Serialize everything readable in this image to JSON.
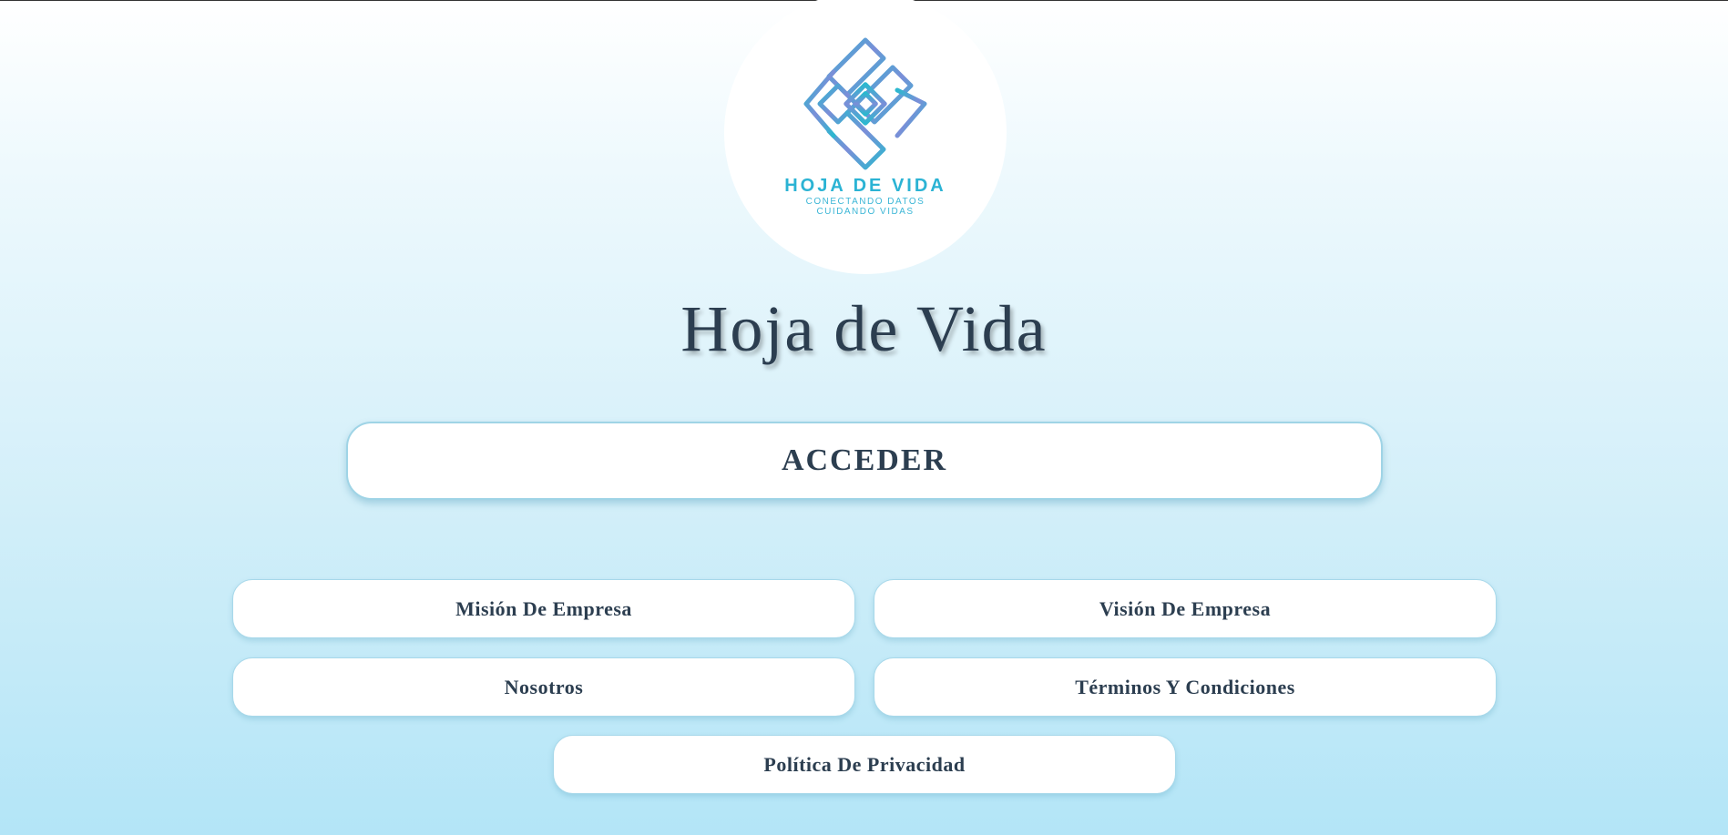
{
  "logo": {
    "icon": "hoja-de-vida-logo-icon",
    "title": "HOJA DE VIDA",
    "tagline_line1": "CONECTANDO DATOS",
    "tagline_line2": "CUIDANDO VIDAS"
  },
  "page": {
    "title": "Hoja de Vida"
  },
  "actions": {
    "access_label": "ACCEDER"
  },
  "links": {
    "mision": "Misión De Empresa",
    "vision": "Visión De Empresa",
    "nosotros": "Nosotros",
    "terminos": "Términos Y Condiciones",
    "privacidad": "Política De Privacidad"
  },
  "colors": {
    "text": "#2c3e50",
    "logo_teal": "#2bb3d4",
    "logo_purple": "#7b8ed8",
    "background_bottom": "#b3e5f7"
  }
}
